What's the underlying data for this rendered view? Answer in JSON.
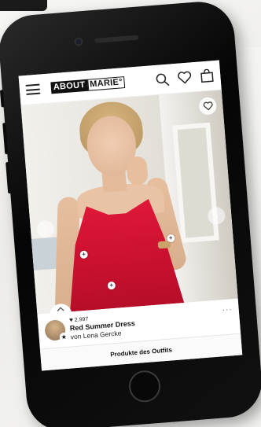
{
  "brand": {
    "logo_part1": "ABOUT",
    "logo_part2": "MARIE°"
  },
  "header": {
    "icons": [
      "menu-icon",
      "search-icon",
      "heart-icon",
      "bag-icon"
    ]
  },
  "outfit": {
    "likes": "2.997",
    "title": "Red Summer Dress",
    "author": "von Lena Gercke",
    "more_label": "···",
    "hotspot_symbol": "+"
  },
  "navigation": {
    "prev_symbol": "‹",
    "next_symbol": "›"
  },
  "products_tab": {
    "label": "Produkte des Outfits"
  },
  "colors": {
    "dress": "#c8102e",
    "phone": "#0a0a0a",
    "accent": "#111111"
  }
}
